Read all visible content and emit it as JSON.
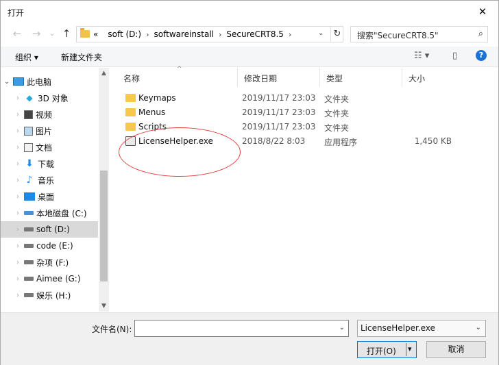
{
  "window": {
    "title": "打开",
    "close": "✕"
  },
  "nav": {
    "back": "←",
    "forward": "→",
    "recent": "⌄",
    "up": "↑",
    "breadcrumb_overflow": "«",
    "breadcrumbs": [
      "soft (D:)",
      "softwareinstall",
      "SecureCRT8.5"
    ],
    "breadcrumb_separator": "›",
    "dropdown": "⌄",
    "refresh": "↻"
  },
  "search": {
    "placeholder": "搜索\"SecureCRT8.5\"",
    "icon": "⌕"
  },
  "toolbar": {
    "organize": "组织 ▾",
    "new_folder": "新建文件夹",
    "view_icon": "☷ ▾",
    "pane_icon": "▯",
    "help": "?"
  },
  "sidebar": {
    "items": [
      {
        "label": "此电脑",
        "icon": "computer-icon",
        "expanded": true
      },
      {
        "label": "3D 对象",
        "icon": "cube-icon"
      },
      {
        "label": "视频",
        "icon": "video-icon"
      },
      {
        "label": "图片",
        "icon": "picture-icon"
      },
      {
        "label": "文档",
        "icon": "document-icon"
      },
      {
        "label": "下载",
        "icon": "download-icon",
        "glyph": "⬇"
      },
      {
        "label": "音乐",
        "icon": "music-icon",
        "glyph": "♪"
      },
      {
        "label": "桌面",
        "icon": "desktop-icon"
      },
      {
        "label": "本地磁盘 (C:)",
        "icon": "system-drive-icon"
      },
      {
        "label": "soft (D:)",
        "icon": "drive-icon",
        "selected": true
      },
      {
        "label": "code (E:)",
        "icon": "drive-icon"
      },
      {
        "label": "杂项 (F:)",
        "icon": "drive-icon"
      },
      {
        "label": "Aimee (G:)",
        "icon": "drive-icon"
      },
      {
        "label": "娱乐 (H:)",
        "icon": "drive-icon"
      }
    ],
    "chevron_collapsed": "›",
    "chevron_expanded": "⌄"
  },
  "scrollbar": {
    "up": "▲",
    "down": "▼"
  },
  "columns": {
    "name": "名称",
    "date": "修改日期",
    "type": "类型",
    "size": "大小",
    "sort_indicator": "^"
  },
  "files": [
    {
      "name": "Keymaps",
      "date": "2019/11/17 23:03",
      "type": "文件夹",
      "size": "",
      "kind": "folder"
    },
    {
      "name": "Menus",
      "date": "2019/11/17 23:03",
      "type": "文件夹",
      "size": "",
      "kind": "folder"
    },
    {
      "name": "Scripts",
      "date": "2019/11/17 23:03",
      "type": "文件夹",
      "size": "",
      "kind": "folder"
    },
    {
      "name": "LicenseHelper.exe",
      "date": "2018/8/22 8:03",
      "type": "应用程序",
      "size": "1,450 KB",
      "kind": "exe"
    }
  ],
  "annotation_color": "#e23b3b",
  "footer": {
    "filename_label": "文件名(N):",
    "filename_value": "",
    "filter_value": "LicenseHelper.exe",
    "dropdown": "⌄",
    "open_label": "打开(O)",
    "open_arrow": "▾",
    "cancel_label": "取消"
  }
}
